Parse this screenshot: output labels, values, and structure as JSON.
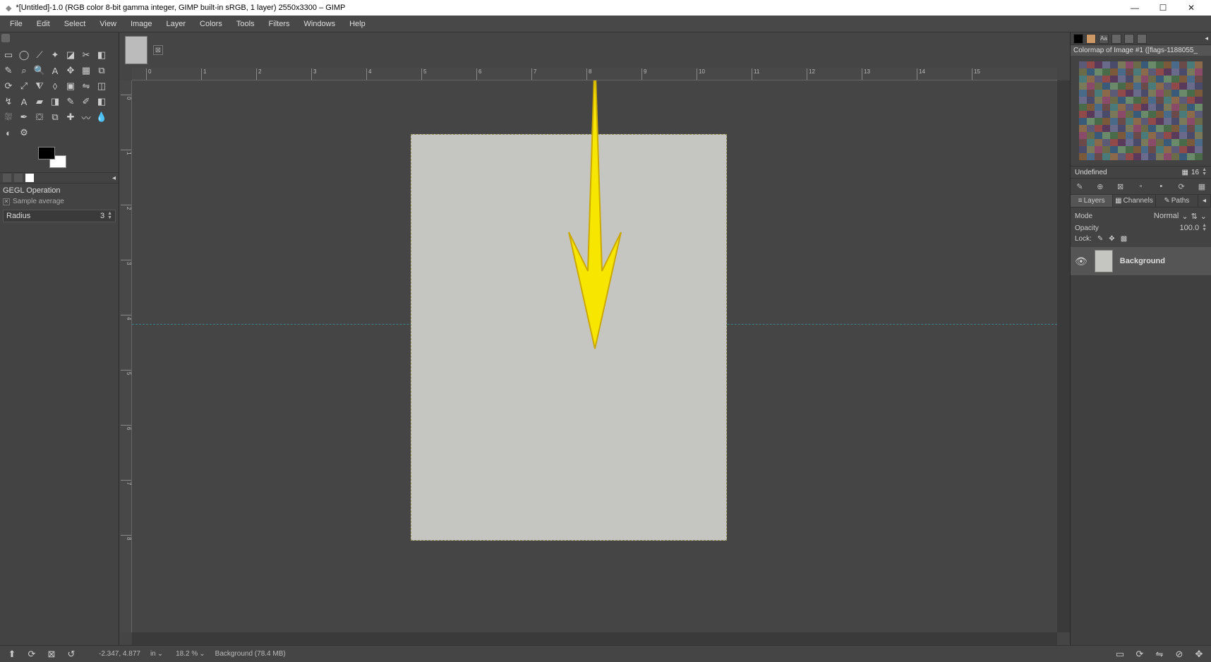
{
  "titlebar": {
    "title": "*[Untitled]-1.0 (RGB color 8-bit gamma integer, GIMP built-in sRGB, 1 layer) 2550x3300 – GIMP"
  },
  "menu": [
    "File",
    "Edit",
    "Select",
    "View",
    "Image",
    "Layer",
    "Colors",
    "Tools",
    "Filters",
    "Windows",
    "Help"
  ],
  "tool_options": {
    "title": "GEGL Operation",
    "sample_avg": "Sample average",
    "radius_label": "Radius",
    "radius_value": "3"
  },
  "ruler_h_labels": [
    "0",
    "1",
    "2",
    "3",
    "4",
    "5",
    "6",
    "7",
    "8",
    "9",
    "10",
    "11",
    "12",
    "13",
    "14",
    "15"
  ],
  "ruler_v_labels": [
    "0",
    "1",
    "2",
    "3",
    "4",
    "5",
    "6",
    "7",
    "8"
  ],
  "colormap": {
    "title": "Colormap of Image #1 ([flags-1188055_",
    "undefined": "Undefined",
    "cols": "16"
  },
  "layers": {
    "tab_layers": "Layers",
    "tab_channels": "Channels",
    "tab_paths": "Paths",
    "mode_label": "Mode",
    "mode_value": "Normal",
    "opacity_label": "Opacity",
    "opacity_value": "100.0",
    "lock_label": "Lock:",
    "layer_name": "Background"
  },
  "statusbar": {
    "coords": "-2.347, 4.877",
    "unit": "in",
    "zoom": "18.2 %",
    "info": "Background (78.4 MB)"
  }
}
